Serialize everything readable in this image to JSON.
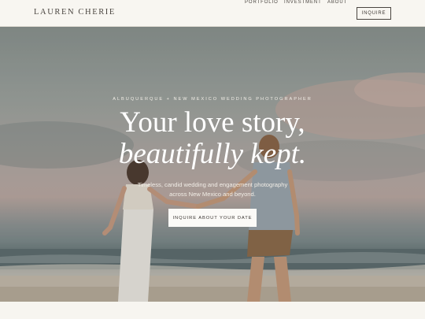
{
  "nav": {
    "brand": "LAUREN CHERIE",
    "links": [
      "PORTFOLIO",
      "INVESTMENT",
      "ABOUT"
    ],
    "inquire_label": "INQUIRE"
  },
  "hero": {
    "eyebrow": "ALBUQUERQUE + NEW MEXICO WEDDING PHOTOGRAPHER",
    "headline_line1": "Your love story,",
    "headline_line2": "beautifully kept.",
    "subtitle_line1": "Timeless, candid wedding and engagement photography",
    "subtitle_line2": "across New Mexico and beyond.",
    "cta_label": "INQUIRE ABOUT YOUR DATE",
    "photo_subject": "couple-walking-on-beach"
  },
  "colors": {
    "background": "#f7f5f0",
    "text_dark": "#4a4540",
    "hero_text": "#ffffff"
  }
}
